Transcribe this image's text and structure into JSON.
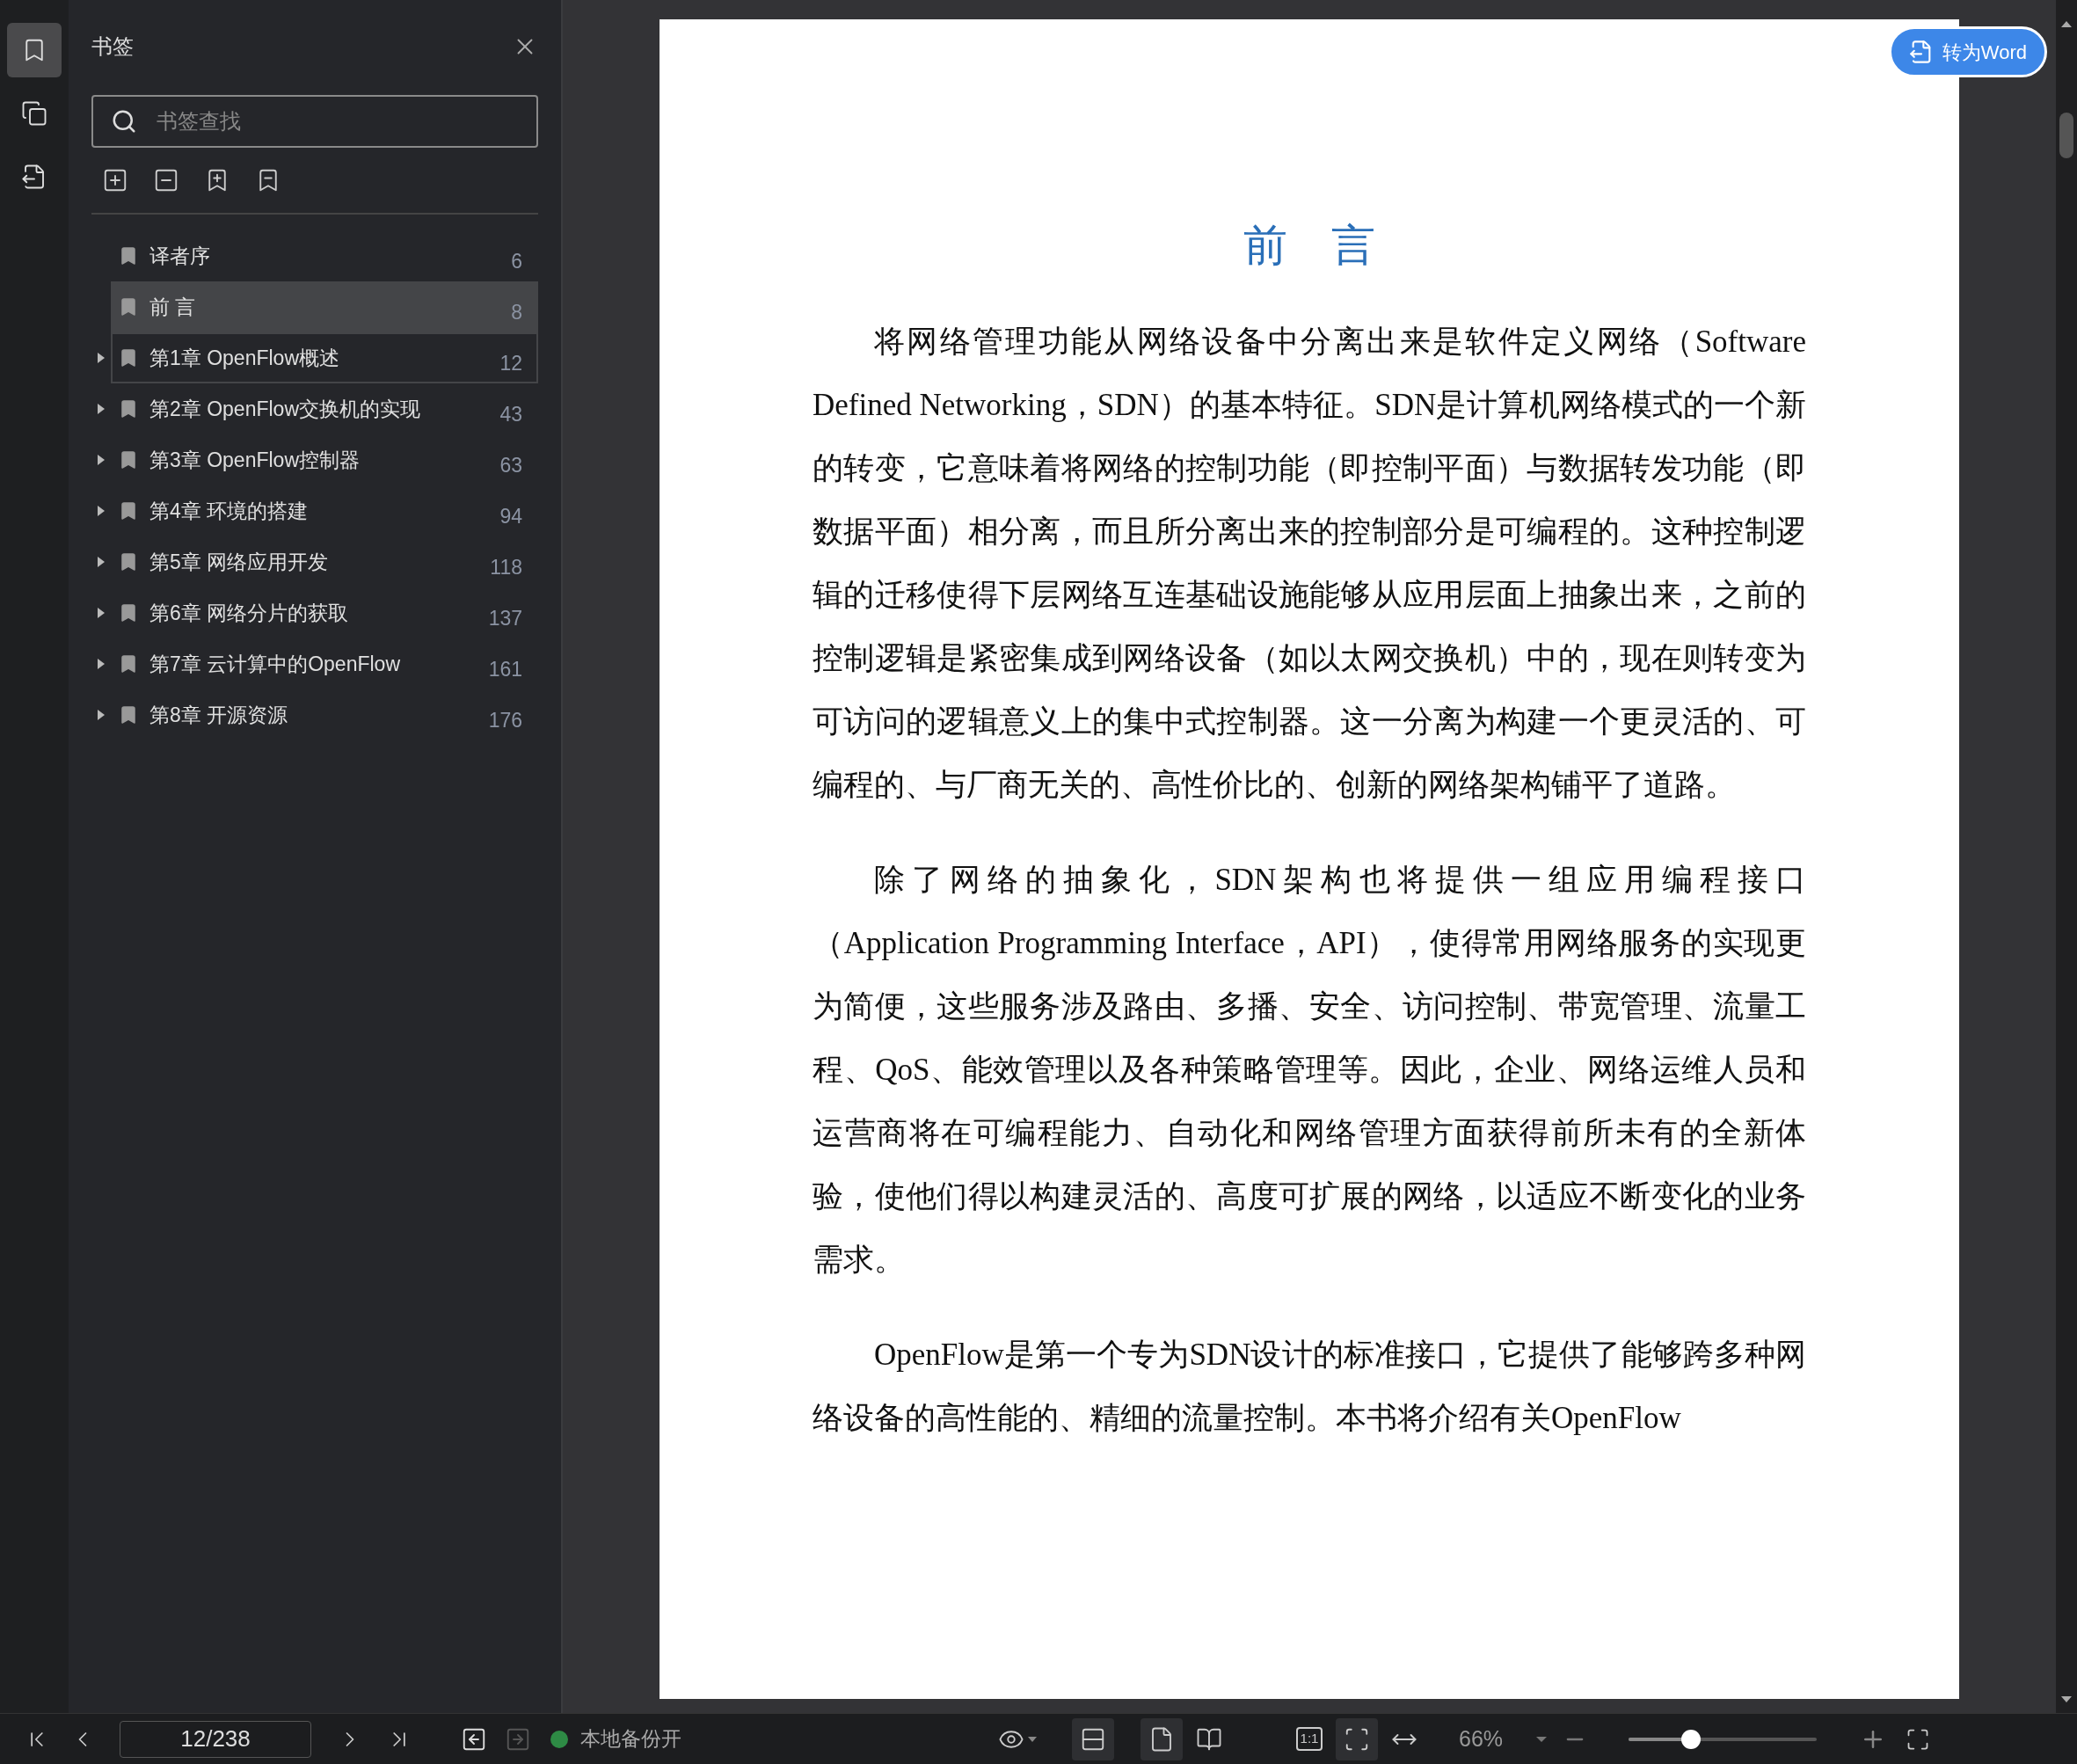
{
  "rail": [
    {
      "kind": "bookmarks",
      "selected": true
    },
    {
      "kind": "thumbnails",
      "selected": false
    },
    {
      "kind": "convert",
      "selected": false
    }
  ],
  "panel": {
    "title": "书签",
    "search": {
      "placeholder": "书签查找"
    },
    "tools": [
      {
        "kind": "expand-all"
      },
      {
        "kind": "collapse-all"
      },
      {
        "kind": "add-bookmark"
      },
      {
        "kind": "remove-bookmark"
      }
    ]
  },
  "bookmarks": [
    {
      "label": "译者序",
      "page": "6",
      "kind": "section",
      "selected": false,
      "focused": false
    },
    {
      "label": "前 言",
      "page": "8",
      "kind": "section",
      "selected": true,
      "focused": false
    },
    {
      "label": "第1章 OpenFlow概述",
      "page": "12",
      "kind": "chapter",
      "selected": false,
      "focused": true
    },
    {
      "label": "第2章 OpenFlow交换机的实现",
      "page": "43",
      "kind": "chapter",
      "selected": false,
      "focused": false
    },
    {
      "label": "第3章 OpenFlow控制器",
      "page": "63",
      "kind": "chapter",
      "selected": false,
      "focused": false
    },
    {
      "label": "第4章 环境的搭建",
      "page": "94",
      "kind": "chapter",
      "selected": false,
      "focused": false
    },
    {
      "label": "第5章 网络应用开发",
      "page": "118",
      "kind": "chapter",
      "selected": false,
      "focused": false
    },
    {
      "label": "第6章 网络分片的获取",
      "page": "137",
      "kind": "chapter",
      "selected": false,
      "focused": false
    },
    {
      "label": "第7章 云计算中的OpenFlow",
      "page": "161",
      "kind": "chapter",
      "selected": false,
      "focused": false
    },
    {
      "label": "第8章 开源资源",
      "page": "176",
      "kind": "chapter",
      "selected": false,
      "focused": false
    }
  ],
  "convert_button": "转为Word",
  "document": {
    "heading": "前　言",
    "paragraphs": [
      "将网络管理功能从网络设备中分离出来是软件定义网络（Software Defined Networking，SDN）的基本特征。SDN是计算机网络模式的一个新的转变，它意味着将网络的控制功能（即控制平面）与数据转发功能（即数据平面）相分离，而且所分离出来的控制部分是可编程的。这种控制逻辑的迁移使得下层网络互连基础设施能够从应用层面上抽象出来，之前的控制逻辑是紧密集成到网络设备（如以太网交换机）中的，现在则转变为可访问的逻辑意义上的集中式控制器。这一分离为构建一个更灵活的、可编程的、与厂商无关的、高性价比的、创新的网络架构铺平了道路。",
      "除了网络的抽象化，SDN架构也将提供一组应用编程接口（Application Programming Interface，API），使得常用网络服务的实现更为简便，这些服务涉及路由、多播、安全、访问控制、带宽管理、流量工程、QoS、能效管理以及各种策略管理等。因此，企业、网络运维人员和运营商将在可编程能力、自动化和网络管理方面获得前所未有的全新体验，使他们得以构建灵活的、高度可扩展的网络，以适应不断变化的业务需求。",
      "OpenFlow是第一个专为SDN设计的标准接口，它提供了能够跨多种网络设备的高性能的、精细的流量控制。本书将介绍有关OpenFlow"
    ]
  },
  "status_bar": {
    "page_field": "12/238",
    "history": [
      {
        "kind": "back",
        "disabled": false
      },
      {
        "kind": "forward",
        "disabled": true
      }
    ],
    "backup": {
      "label": "本地备份开",
      "color": "#2e8b45"
    },
    "view_buttons": [
      {
        "kind": "continuous",
        "selected": true
      },
      {
        "kind": "single",
        "selected": true
      },
      {
        "kind": "double",
        "selected": false
      },
      {
        "kind": "actual",
        "label": "1:1",
        "selected": false
      },
      {
        "kind": "fit-page",
        "selected": true
      },
      {
        "kind": "fit-width",
        "selected": false
      }
    ],
    "zoom": {
      "value": "66%",
      "level": 0.33
    }
  }
}
